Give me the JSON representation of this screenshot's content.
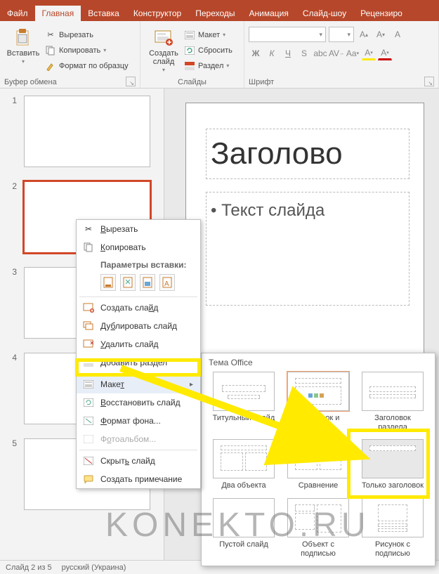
{
  "tabs": {
    "file": "Файл",
    "home": "Главная",
    "insert": "Вставка",
    "design": "Конструктор",
    "transitions": "Переходы",
    "animations": "Анимация",
    "slideshow": "Слайд-шоу",
    "review": "Рецензиро"
  },
  "ribbon": {
    "paste": "Вставить",
    "cut": "Вырезать",
    "copy": "Копировать",
    "format_painter": "Формат по образцу",
    "clipboard_group": "Буфер обмена",
    "new_slide": "Создать\nслайд",
    "layout": "Макет",
    "reset": "Сбросить",
    "section": "Раздел",
    "slides_group": "Слайды",
    "font_group": "Шрифт",
    "font_name_placeholder": "",
    "font_size_placeholder": ""
  },
  "slide": {
    "title": "Заголово",
    "body": "• Текст слайда"
  },
  "thumbs": [
    "1",
    "2",
    "3",
    "4",
    "5"
  ],
  "ctx": {
    "cut": "Вырезать",
    "copy": "Копировать",
    "paste_options": "Параметры вставки:",
    "new_slide": "Создать слайд",
    "duplicate": "Дублировать слайд",
    "delete": "Удалить слайд",
    "add_section": "Добавить раздел",
    "layout": "Макет",
    "reset_slide": "Восстановить слайд",
    "format_bg": "Формат фона...",
    "photo_album": "Фотоальбом...",
    "hide": "Скрыть слайд",
    "new_comment": "Создать примечание"
  },
  "flyout": {
    "theme_label": "Тема Office",
    "layouts": [
      "Титульный слайд",
      "Заголовок и объект",
      "Заголовок раздела",
      "Два объекта",
      "Сравнение",
      "Только заголовок",
      "Пустой слайд",
      "Объект с подписью",
      "Рисунок с подписью"
    ]
  },
  "status": {
    "slide_counter": "Слайд 2 из 5",
    "language": "русский (Украина)"
  },
  "watermark": "KONEKTO.RU"
}
